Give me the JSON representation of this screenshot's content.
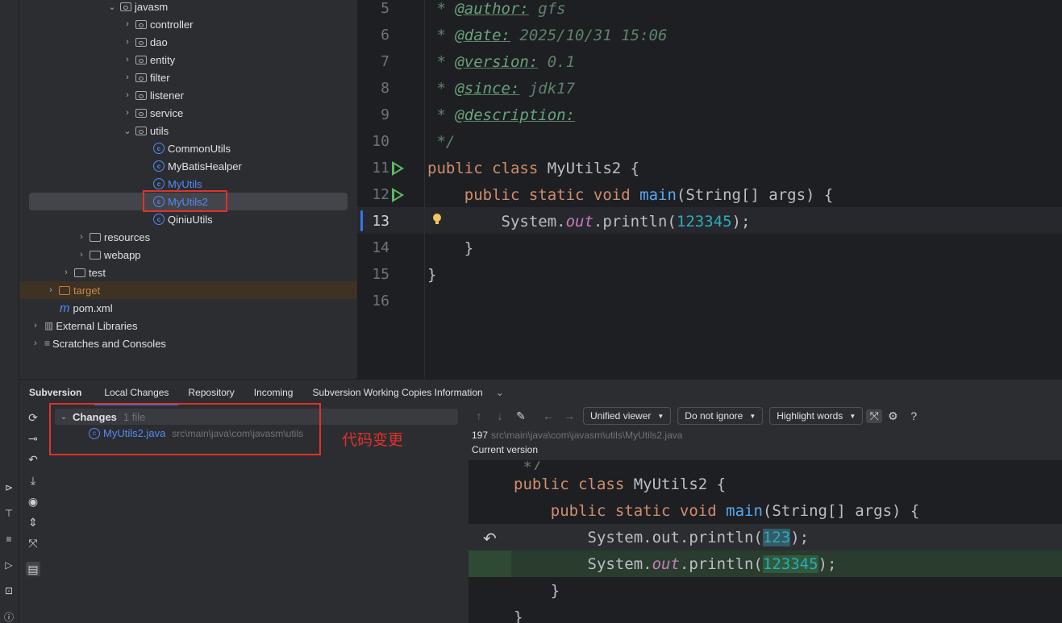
{
  "tree": {
    "rows": [
      {
        "label": "javasm",
        "icon": "package-folder-icon"
      },
      {
        "label": "controller",
        "icon": "package-folder-icon"
      },
      {
        "label": "dao",
        "icon": "package-folder-icon"
      },
      {
        "label": "entity",
        "icon": "package-folder-icon"
      },
      {
        "label": "filter",
        "icon": "package-folder-icon"
      },
      {
        "label": "listener",
        "icon": "package-folder-icon"
      },
      {
        "label": "service",
        "icon": "package-folder-icon"
      },
      {
        "label": "utils",
        "icon": "package-folder-icon"
      },
      {
        "label": "CommonUtils",
        "icon": "class-icon"
      },
      {
        "label": "MyBatisHealper",
        "icon": "class-icon"
      },
      {
        "label": "MyUtils",
        "icon": "class-icon"
      },
      {
        "label": "MyUtils2",
        "icon": "runnable-class-icon"
      },
      {
        "label": "QiniuUtils",
        "icon": "runnable-class-icon"
      },
      {
        "label": "resources",
        "icon": "resources-folder-icon"
      },
      {
        "label": "webapp",
        "icon": "folder-icon"
      },
      {
        "label": "test",
        "icon": "folder-icon"
      },
      {
        "label": "target",
        "icon": "excluded-folder-icon"
      },
      {
        "label": "pom.xml",
        "icon": "maven-icon"
      },
      {
        "label": "External Libraries",
        "icon": "library-icon"
      },
      {
        "label": "Scratches and Consoles",
        "icon": "scratches-icon"
      }
    ]
  },
  "editor": {
    "line_numbers": [
      "5",
      "6",
      "7",
      "8",
      "9",
      "10",
      "11",
      "12",
      "13",
      "14",
      "15",
      "16"
    ],
    "lines": {
      "l5_tag": "@author:",
      "l5_val": " gfs",
      "l6_tag": "@date:",
      "l6_val": " 2025/10/31 15:06",
      "l7_tag": "@version:",
      "l7_val": " 0.1",
      "l8_tag": "@since:",
      "l8_val": " jdk17",
      "l9_tag": "@description:",
      "l10": "*/",
      "l11_kw": "public class",
      "l11_name": " MyUtils2 {",
      "l12_kw": "public static void",
      "l12_fn": "main",
      "l12_rest": "(String[] args) {",
      "l13_a": "System.",
      "l13_out": "out",
      "l13_b": ".println(",
      "l13_num": "123345",
      "l13_c": ");",
      "l14": "}",
      "l15": "}"
    }
  },
  "bottom": {
    "tabs": {
      "title": "Subversion",
      "local_changes": "Local Changes",
      "repository": "Repository",
      "incoming": "Incoming",
      "working_copies": "Subversion Working Copies Information"
    },
    "changes": {
      "label": "Changes",
      "count": "1 file",
      "file_name": "MyUtils2.java",
      "file_path": "src\\main\\java\\com\\javasm\\utils"
    },
    "annotation": "代码变更"
  },
  "diff": {
    "toolbar": {
      "viewer": "Unified viewer",
      "ignore": "Do not ignore",
      "highlight": "Highlight words",
      "help": "?"
    },
    "info": {
      "revision": "197",
      "path": "src\\main\\java\\com\\javasm\\utils\\MyUtils2.java",
      "version_label": "Current version"
    },
    "lines": {
      "d0": "*/",
      "d1_kw": "public class",
      "d1_rest": " MyUtils2 {",
      "d2_kw": "public static void",
      "d2_fn": "main",
      "d2_rest": "(String[] args) {",
      "d3_a": "System.out.println(",
      "d3_num": "123",
      "d3_c": ");",
      "d4_a": "System.",
      "d4_out": "out",
      "d4_b": ".println(",
      "d4_num": "123345",
      "d4_c": ");",
      "d5": "}",
      "d6": "}"
    }
  }
}
